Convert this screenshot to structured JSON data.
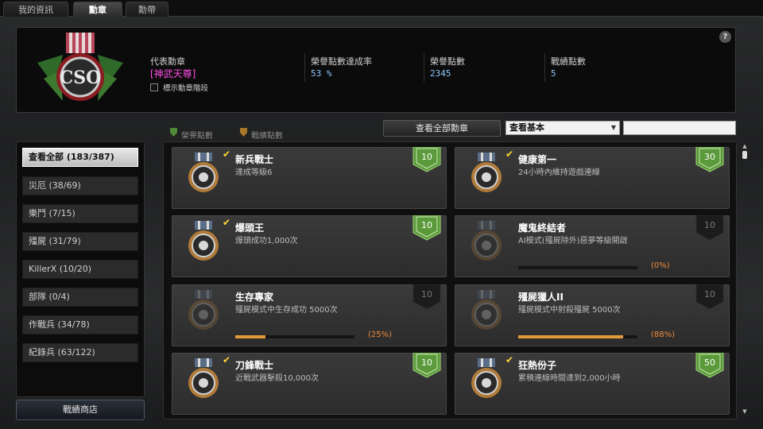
{
  "tabs": [
    {
      "label": "我的資訊",
      "active": false
    },
    {
      "label": "勳章",
      "active": true
    },
    {
      "label": "勳帶",
      "active": false
    }
  ],
  "header": {
    "representative_label": "代表勳章",
    "representative_name": "[神武天尊]",
    "show_stage_label": "標示勳章階段",
    "help_label": "?",
    "stats": [
      {
        "label": "榮譽點數達成率",
        "value": "53 %"
      },
      {
        "label": "榮譽點數",
        "value": "2345"
      },
      {
        "label": "戰績點數",
        "value": "5"
      }
    ]
  },
  "legend": {
    "honor_points": "榮譽點數",
    "battle_points": "戰績點數"
  },
  "controls": {
    "view_all_button": "查看全部勳章",
    "filter_selected": "查看基本",
    "search_value": ""
  },
  "sidebar": {
    "categories": [
      {
        "label": "查看全部 (183/387)",
        "active": true
      },
      {
        "label": "災厄 (38/69)",
        "active": false
      },
      {
        "label": "樂鬥 (7/15)",
        "active": false
      },
      {
        "label": "殭屍 (31/79)",
        "active": false
      },
      {
        "label": "KillerX (10/20)",
        "active": false
      },
      {
        "label": "部隊 (0/4)",
        "active": false
      },
      {
        "label": "作戰兵 (34/78)",
        "active": false
      },
      {
        "label": "紀錄兵 (63/122)",
        "active": false
      }
    ],
    "shop_button": "戰績商店"
  },
  "medals": [
    {
      "name": "新兵戰士",
      "desc": "達成等級6",
      "points": "10",
      "earned": true,
      "icon": "welcome-cso-medal-icon",
      "progress": null,
      "progress_label": ""
    },
    {
      "name": "健康第一",
      "desc": "24小時內維持遊戲連線",
      "points": "30",
      "earned": true,
      "icon": "clock-medal-icon",
      "progress": null,
      "progress_label": ""
    },
    {
      "name": "爆頭王",
      "desc": "爆頭成功1,000次",
      "points": "10",
      "earned": true,
      "icon": "skull-medal-icon",
      "progress": null,
      "progress_label": ""
    },
    {
      "name": "魔鬼終結者",
      "desc": "AI模式(殭屍除外)惡夢等級開啟",
      "points": "10",
      "earned": false,
      "icon": "demon-medal-icon",
      "progress": 0,
      "progress_label": "(0%)"
    },
    {
      "name": "生存專家",
      "desc": "殭屍模式中生存成功 5000次",
      "points": "10",
      "earned": false,
      "icon": "survival-medal-icon",
      "progress": 0.25,
      "progress_label": "(25%)"
    },
    {
      "name": "殭屍獵人II",
      "desc": "殭屍模式中射殺殭屍 5000次",
      "points": "10",
      "earned": false,
      "icon": "zombie-hunter-medal-icon",
      "progress": 0.88,
      "progress_label": "(88%)"
    },
    {
      "name": "刀鋒戰士",
      "desc": "近戰武器擊殺10,000次",
      "points": "10",
      "earned": true,
      "icon": "crossed-swords-medal-icon",
      "progress": null,
      "progress_label": ""
    },
    {
      "name": "狂熱份子",
      "desc": "累積連線時間達到2,000小時",
      "points": "50",
      "earned": true,
      "icon": "gold-cso-medal-icon",
      "progress": null,
      "progress_label": ""
    }
  ],
  "colors": {
    "earned_badge": "#5a9a3a",
    "locked_badge": "#1c1c1c",
    "progress": "#e39a3a",
    "rep_name": "#ff4ce6",
    "stat_value": "#8fc8ff"
  }
}
